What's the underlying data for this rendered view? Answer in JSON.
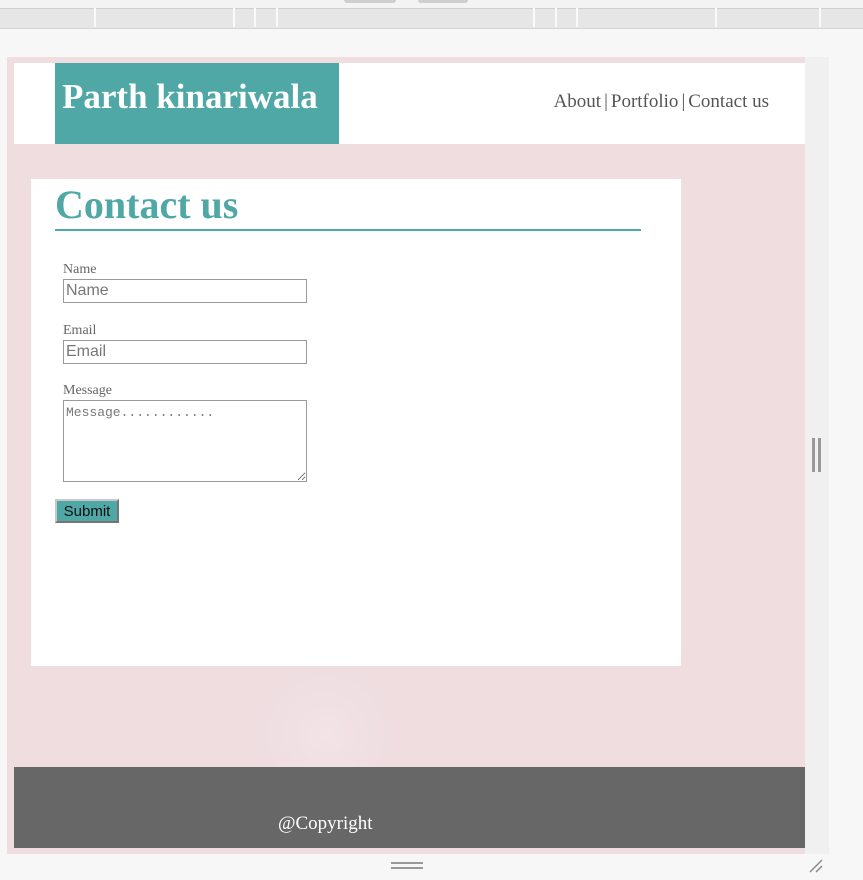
{
  "header": {
    "brand": "Parth kinariwala",
    "nav": [
      {
        "label": "About"
      },
      {
        "label": "Portfolio"
      },
      {
        "label": "Contact us"
      }
    ],
    "separator": "|"
  },
  "contact": {
    "title": "Contact us",
    "name_label": "Name",
    "name_placeholder": "Name",
    "email_label": "Email",
    "email_placeholder": "Email",
    "message_label": "Message",
    "message_placeholder": "Message............",
    "submit_label": "Submit"
  },
  "footer": {
    "copyright": "@Copyright"
  },
  "colors": {
    "accent": "#4fa8a5",
    "page_background": "#efdde0",
    "footer_background": "#676767"
  }
}
